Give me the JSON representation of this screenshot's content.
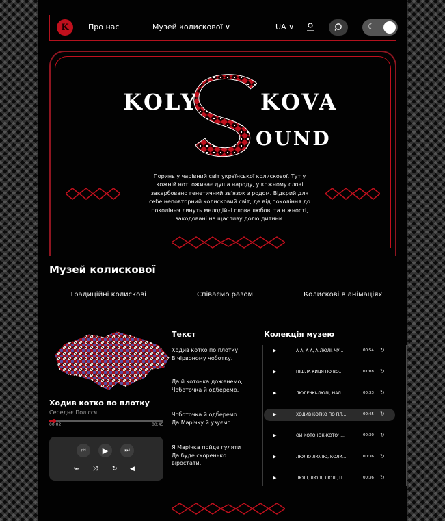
{
  "header": {
    "logo_letter": "K",
    "nav_about": "Про нас",
    "nav_museum": "Музей колискової",
    "lang": "UA",
    "icons": [
      "user-icon",
      "search-icon",
      "moon-icon"
    ]
  },
  "hero": {
    "title_left": "KOLY",
    "title_right": "KOVA",
    "title_bottom": "OUND",
    "text": "Поринь у чарівний світ української колискової. Тут у кожній ноті оживає душа народу, у кожному слові закарбовано генетичний зв'язок з родом. Відкрий для себе неповторний колисковий світ, де від покоління до покоління линуть мелодійні слова любові та ніжності, закодовані на щасливу долю дитини."
  },
  "museum": {
    "title": "Музей колискової",
    "tabs": [
      "Традиційні колискові",
      "Співаємо разом",
      "Колискові в анімаціях"
    ]
  },
  "player": {
    "song_title": "Ходив котко по плотку",
    "region": "Середнє Полісся",
    "time_current": "00:02",
    "time_total": "00:45",
    "progress": 0.04
  },
  "lyrics": {
    "heading": "Текст",
    "verses": [
      "Ходив котко по плотку\nВ чірвоному чоботку.",
      "Да й коточка доженемо,\nЧоботочка й одберемо.",
      "Чоботочка й одберемо\nДа Марічку й узуємо.",
      "Я Марічка пойде гуляти\nДа буде скоренько віростати."
    ]
  },
  "collection": {
    "heading": "Колекція музею",
    "items": [
      {
        "name": "А-А, А-А, А-ЛЮЛІ. ЧУ...",
        "duration": "00:54",
        "active": false
      },
      {
        "name": "ПІШЛА КИЦЯ ПО ВО...",
        "duration": "01:08",
        "active": false
      },
      {
        "name": "ЛЮЛЕЧКІ-ЛЮЛІ, НАЛ...",
        "duration": "00:33",
        "active": false
      },
      {
        "name": "ХОДИВ КОТКО ПО ПЛ...",
        "duration": "00:45",
        "active": true
      },
      {
        "name": "ОЙ КОТОЧОК-КОТОЧ...",
        "duration": "00:30",
        "active": false
      },
      {
        "name": "ЛЮЛЮ-ЛЮЛЮ, КОЛИ...",
        "duration": "00:36",
        "active": false
      },
      {
        "name": "ЛЮЛІ, ЛЮЛІ, ЛЮЛІ, П...",
        "duration": "00:36",
        "active": false
      }
    ]
  },
  "colors": {
    "accent": "#c0101d",
    "background": "#020202"
  }
}
